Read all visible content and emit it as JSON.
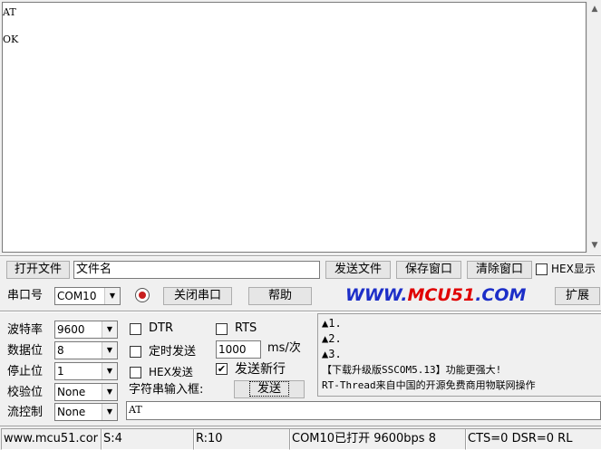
{
  "receive": {
    "text": "AT\n\nOK"
  },
  "file_row": {
    "open_file": "打开文件",
    "filename": "文件名",
    "send_file": "发送文件",
    "save_window": "保存窗口",
    "clear_window": "清除窗口",
    "hex_display": "HEX显示"
  },
  "port_row": {
    "port_label": "串口号",
    "port_value": "COM10",
    "close_port": "关闭串口",
    "help": "帮助",
    "site": "WWW.MCU51.COM",
    "expand": "扩展"
  },
  "settings": {
    "baud_label": "波特率",
    "baud_value": "9600",
    "databits_label": "数据位",
    "databits_value": "8",
    "stopbits_label": "停止位",
    "stopbits_value": "1",
    "parity_label": "校验位",
    "parity_value": "None",
    "flow_label": "流控制",
    "flow_value": "None"
  },
  "options": {
    "dtr": "DTR",
    "dtr_checked": false,
    "rts": "RTS",
    "rts_checked": false,
    "timed_send": "定时发送",
    "timed_checked": false,
    "interval": "1000",
    "interval_unit": "ms/次",
    "hex_send": "HEX发送",
    "hex_send_checked": false,
    "send_newline": "发送新行",
    "newline_checked": true,
    "input_label": "字符串输入框:",
    "send_button": "发送",
    "input_value": "AT"
  },
  "info_panel": {
    "line1": "▲1.",
    "line2": "▲2.",
    "line3": "▲3.",
    "line4": "【下载升级版SSCOM5.13】功能更强大!",
    "line5": "RT-Thread来自中国的开源免费商用物联网操作"
  },
  "status": {
    "site": "www.mcu51.cor",
    "sent": "S:4",
    "received": "R:10",
    "port_state": "COM10已打开  9600bps  8",
    "signals": "CTS=0 DSR=0 RL"
  },
  "colors": {
    "site_blue": "#1c2ec8",
    "site_red": "#e00000",
    "record_red": "#c81e1e"
  }
}
